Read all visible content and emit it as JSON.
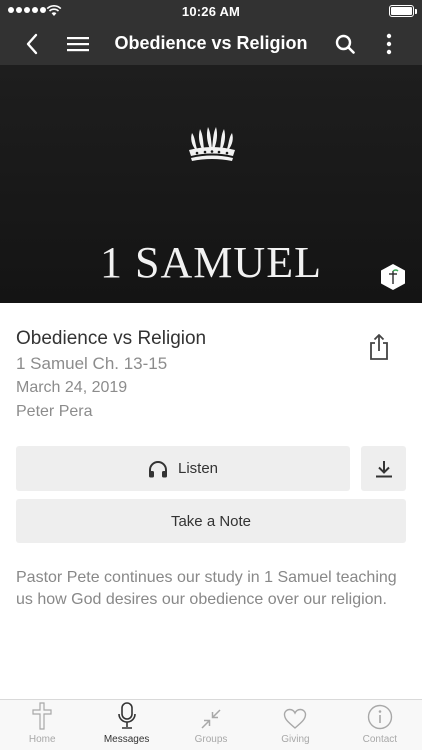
{
  "status_bar": {
    "time": "10:26 AM"
  },
  "nav": {
    "title": "Obedience vs Religion",
    "back_icon": "chevron-left-icon",
    "menu_icon": "hamburger-menu-icon",
    "search_icon": "search-icon",
    "more_icon": "vertical-ellipsis-icon"
  },
  "hero": {
    "book_title": "1 SAMUEL",
    "background": "#1a1a1a"
  },
  "sermon": {
    "title": "Obedience vs Religion",
    "series": "1 Samuel Ch. 13-15",
    "date": "March 24, 2019",
    "speaker": "Peter Pera",
    "description": "Pastor Pete continues our study in 1 Samuel teaching us how God desires our obedience over our religion."
  },
  "actions": {
    "listen_label": "Listen",
    "note_label": "Take a Note",
    "share_icon": "share-icon",
    "download_icon": "download-icon",
    "listen_icon": "headphones-icon"
  },
  "tabs": [
    {
      "label": "Home",
      "icon": "cross-icon",
      "active": false
    },
    {
      "label": "Messages",
      "icon": "microphone-icon",
      "active": true
    },
    {
      "label": "Groups",
      "icon": "arrows-in-icon",
      "active": false
    },
    {
      "label": "Giving",
      "icon": "heart-icon",
      "active": false
    },
    {
      "label": "Contact",
      "icon": "info-icon",
      "active": false
    }
  ],
  "colors": {
    "nav_background": "#323232",
    "button_background": "#eeeeee",
    "secondary_text": "#8c8c8c",
    "active_tab": "#333333",
    "inactive_tab": "#a8a8a8"
  }
}
